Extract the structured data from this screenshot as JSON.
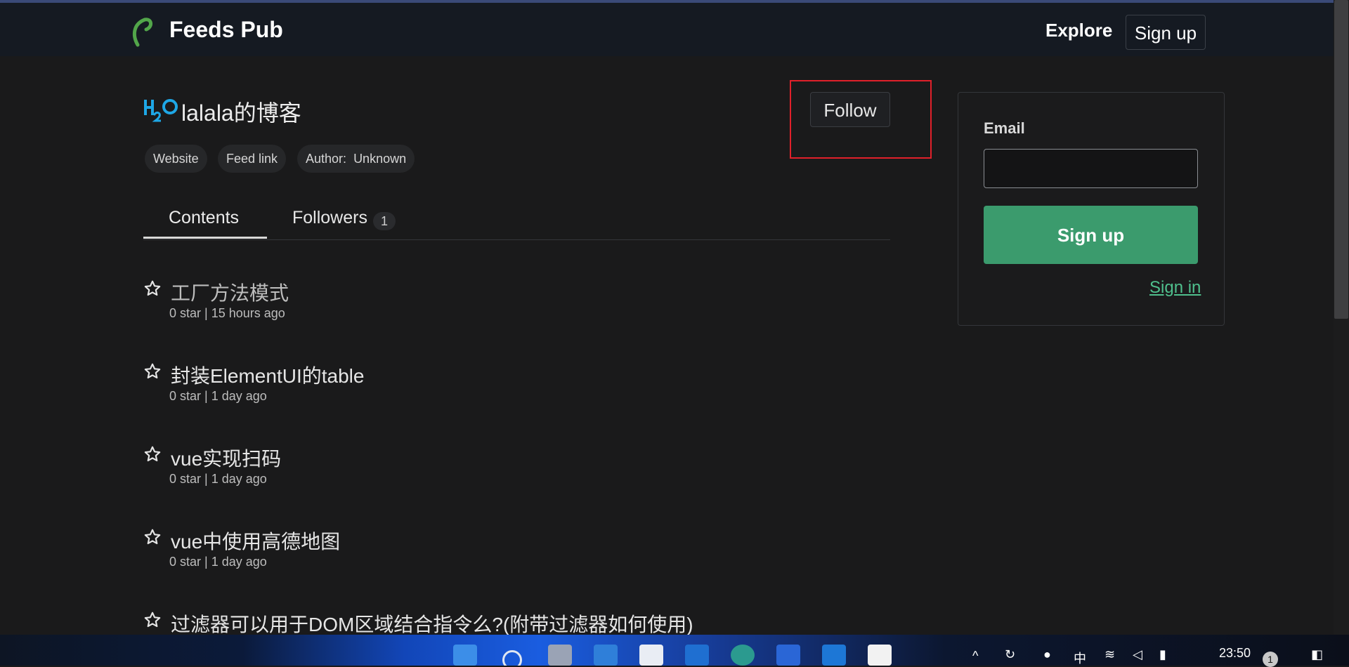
{
  "header": {
    "brand": "Feeds Pub",
    "explore": "Explore",
    "signup": "Sign up"
  },
  "feed": {
    "title": "lalala的博客",
    "links": [
      "Website",
      "Feed link"
    ],
    "author_label": "Author:",
    "author_value": "Unknown",
    "follow": "Follow"
  },
  "tabs": [
    {
      "label": "Contents",
      "active": true
    },
    {
      "label": "Followers",
      "count": "1",
      "active": false
    }
  ],
  "posts": [
    {
      "title": "工厂方法模式",
      "meta": "0 star | 15 hours ago"
    },
    {
      "title": "封装ElementUI的table",
      "meta": "0 star | 1 day ago"
    },
    {
      "title": "vue实现扫码",
      "meta": "0 star | 1 day ago"
    },
    {
      "title": "vue中使用高德地图",
      "meta": "0 star | 1 day ago"
    },
    {
      "title": "过滤器可以用于DOM区域结合指令么?(附带过滤器如何使用)",
      "meta": ""
    }
  ],
  "sidebar": {
    "email_label": "Email",
    "email_value": "",
    "signup_button": "Sign up",
    "signin_link": "Sign in"
  },
  "taskbar": {
    "ime": "中",
    "clock": "23:50",
    "notification_count": "1"
  },
  "colors": {
    "accent_green": "#3b9b6d",
    "link_green": "#4fc08d",
    "highlight_red": "#e0202a"
  }
}
